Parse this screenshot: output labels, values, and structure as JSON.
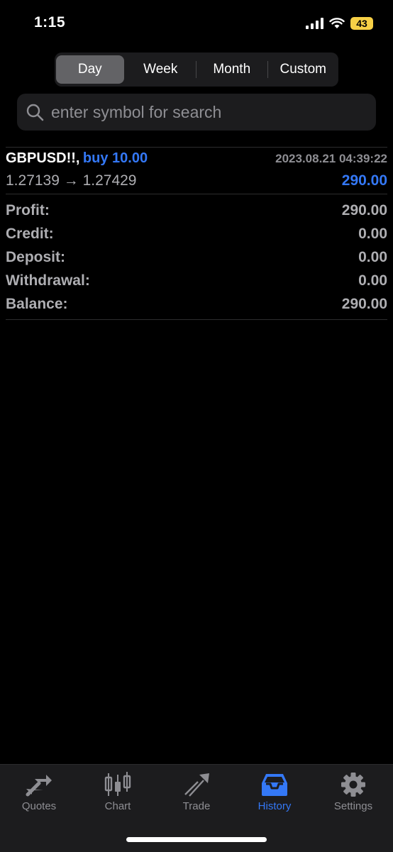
{
  "status_bar": {
    "time": "1:15",
    "battery": "43"
  },
  "periods": {
    "active_index": 0,
    "items": [
      {
        "label": "Day"
      },
      {
        "label": "Week"
      },
      {
        "label": "Month"
      },
      {
        "label": "Custom"
      }
    ]
  },
  "search": {
    "placeholder": "enter symbol for search",
    "value": ""
  },
  "trade": {
    "symbol": "GBPUSD!!,",
    "side": "buy 10.00",
    "datetime": "2023.08.21 04:39:22",
    "prices": "1.27139 → 1.27429",
    "profit": "290.00"
  },
  "summary": [
    {
      "label": "Profit:",
      "value": "290.00"
    },
    {
      "label": "Credit:",
      "value": "0.00"
    },
    {
      "label": "Deposit:",
      "value": "0.00"
    },
    {
      "label": "Withdrawal:",
      "value": "0.00"
    },
    {
      "label": "Balance:",
      "value": "290.00"
    }
  ],
  "tabs": [
    {
      "label": "Quotes",
      "icon": "quotes-icon"
    },
    {
      "label": "Chart",
      "icon": "candlestick-chart-icon"
    },
    {
      "label": "Trade",
      "icon": "trade-icon"
    },
    {
      "label": "History",
      "icon": "inbox-history-icon"
    },
    {
      "label": "Settings",
      "icon": "gear-icon"
    }
  ],
  "colors": {
    "accent": "#3478f6",
    "muted": "#8e8e93",
    "battery": "#f7d046"
  }
}
